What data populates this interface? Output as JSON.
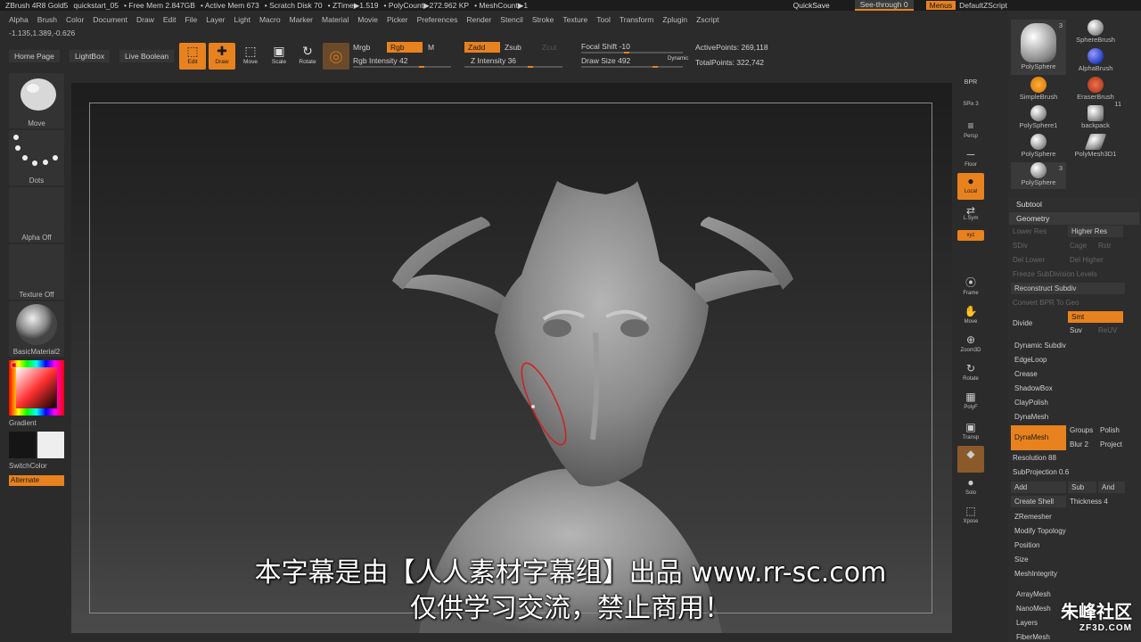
{
  "titlebar": {
    "segments": [
      "ZBrush 4R8 Gold5",
      "quickstart_05",
      "• Free Mem 2.847GB",
      "• Active Mem 673",
      "• Scratch Disk 70",
      "• ZTime▶1.519",
      "• PolyCount▶272.962 KP",
      "• MeshCount▶1"
    ],
    "quicksave": "QuickSave",
    "seethrough": "See-through  0",
    "menus": "Menus",
    "zscript": "DefaultZScript"
  },
  "menubar": [
    "Alpha",
    "Brush",
    "Color",
    "Document",
    "Draw",
    "Edit",
    "File",
    "Layer",
    "Light",
    "Macro",
    "Marker",
    "Material",
    "Movie",
    "Picker",
    "Preferences",
    "Render",
    "Stencil",
    "Stroke",
    "Texture",
    "Tool",
    "Transform",
    "Zplugin",
    "Zscript"
  ],
  "coords": "-1.135,1.389,-0.626",
  "toolbar": {
    "home": "Home Page",
    "lightbox": "LightBox",
    "liveboolean": "Live Boolean",
    "edit": "Edit",
    "draw": "Draw",
    "move": "Move",
    "scale": "Scale",
    "rotate": "Rotate",
    "mrgb": "Mrgb",
    "rgb": "Rgb",
    "m": "M",
    "rgb_intensity": "Rgb Intensity 42",
    "zadd": "Zadd",
    "zsub": "Zsub",
    "zcut": "Zcut",
    "z_intensity": "Z Intensity 36",
    "focal_shift": "Focal Shift -10",
    "draw_size": "Draw Size 492",
    "dynamic": "Dynamic",
    "active_points": "ActivePoints: 269,118",
    "total_points": "TotalPoints: 322,742"
  },
  "leftshelf": {
    "brush": "Move",
    "stroke": "Dots",
    "alpha": "Alpha Off",
    "texture": "Texture Off",
    "material": "BasicMaterial2",
    "gradient": "Gradient",
    "switchcolor": "SwitchColor",
    "alternate": "Alternate"
  },
  "rightshelf": [
    {
      "icon": "BPR",
      "label": ""
    },
    {
      "icon": "",
      "label": "SPix 3"
    },
    {
      "icon": "≡",
      "label": "Persp"
    },
    {
      "icon": "─",
      "label": "Floor"
    },
    {
      "icon": "●",
      "label": "Local"
    },
    {
      "icon": "⇄",
      "label": "L.Sym"
    },
    {
      "icon": "",
      "label": "xyz"
    },
    {
      "icon": "⦿",
      "label": "Frame"
    },
    {
      "icon": "✋",
      "label": "Move"
    },
    {
      "icon": "⊕",
      "label": "Zoom3D"
    },
    {
      "icon": "↻",
      "label": "Rotate"
    },
    {
      "icon": "▦",
      "label": "PolyF"
    },
    {
      "icon": "▣",
      "label": "Transp"
    },
    {
      "icon": "◆",
      "label": "Ghost"
    },
    {
      "icon": "●",
      "label": "Solo"
    },
    {
      "icon": "⬚",
      "label": "Xpose"
    }
  ],
  "rightpanel": {
    "brushes": [
      {
        "name": "PolySphere",
        "count": "3"
      },
      {
        "name": "SphereBrush",
        "count": ""
      },
      {
        "name": "AlphaBrush",
        "count": ""
      },
      {
        "name": "SimpleBrush",
        "count": ""
      },
      {
        "name": "EraserBrush",
        "count": ""
      },
      {
        "name": "PolySphere1",
        "count": ""
      },
      {
        "name": "backpack",
        "count": "11"
      },
      {
        "name": "PolySphere",
        "count": ""
      },
      {
        "name": "PolyMesh3D1",
        "count": ""
      },
      {
        "name": "PolySphere",
        "count": "3"
      }
    ],
    "subtool": "Subtool",
    "geometry": "Geometry",
    "lower_res": "Lower Res",
    "higher_res": "Higher Res",
    "sdiv": "SDiv",
    "cage": "Cage",
    "rstr": "Rstr",
    "del_lower": "Del Lower",
    "del_higher": "Del Higher",
    "freeze": "Freeze SubDivision Levels",
    "reconstruct": "Reconstruct Subdiv",
    "convert": "Convert BPR To Geo",
    "divide": "Divide",
    "smt": "Smt",
    "suv": "Suv",
    "reluv": "ReUV",
    "dynamic_subdiv": "Dynamic Subdiv",
    "edgeloop": "EdgeLoop",
    "crease": "Crease",
    "shadowbox": "ShadowBox",
    "claypolish": "ClayPolish",
    "dynamesh_header": "DynaMesh",
    "dynamesh": "DynaMesh",
    "groups": "Groups",
    "polish": "Polish",
    "blur": "Blur 2",
    "project": "Project",
    "resolution": "Resolution 88",
    "subprojection": "SubProjection 0.6",
    "add": "Add",
    "sub": "Sub",
    "and": "And",
    "create_shell": "Create Shell",
    "thickness": "Thickness 4",
    "zremesher": "ZRemesher",
    "modify_topology": "Modify Topology",
    "position": "Position",
    "size": "Size",
    "meshintegrity": "MeshIntegrity",
    "arraymesh": "ArrayMesh",
    "nanomesh": "NanoMesh",
    "layers": "Layers",
    "fibermesh": "FiberMesh"
  },
  "subtitles": {
    "line1": "本字幕是由【人人素材字幕组】出品 www.rr-sc.com",
    "line2": "仅供学习交流，禁止商用！"
  },
  "watermark": {
    "main": "朱峰社区",
    "sub": "ZF3D.COM"
  },
  "colors": {
    "accent": "#e8821e",
    "panel": "#2d2d2d",
    "viewport": "#2a2a2a"
  }
}
